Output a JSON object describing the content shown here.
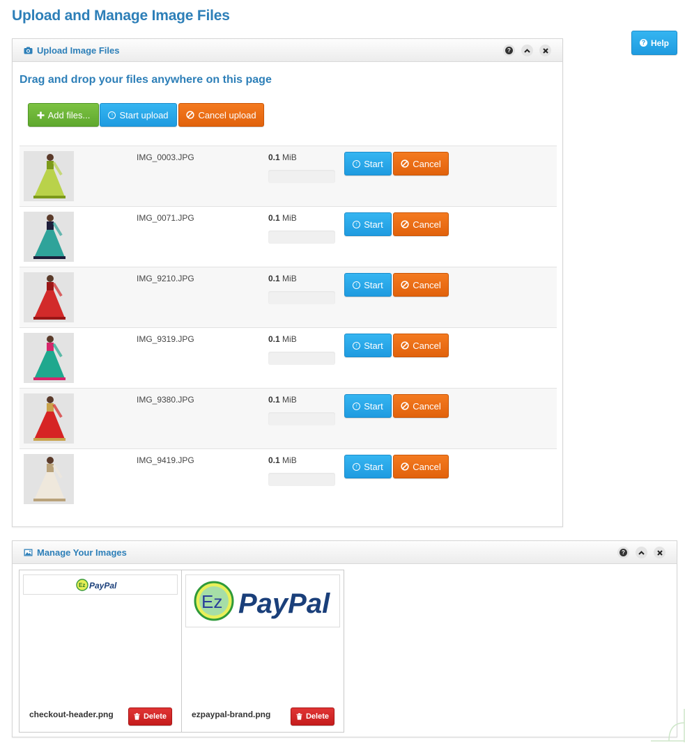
{
  "page": {
    "title": "Upload and Manage Image Files"
  },
  "help": {
    "label": "Help"
  },
  "upload": {
    "title": "Upload Image Files",
    "drag_text": "Drag and drop your files anywhere on this page",
    "add_label": "Add files...",
    "start_label": "Start upload",
    "cancel_label": "Cancel upload",
    "files": [
      {
        "name": "IMG_0003.JPG",
        "size_value": "0.1",
        "size_unit": "MiB",
        "start_label": "Start",
        "cancel_label": "Cancel",
        "dress": "#b9d24a",
        "accent": "#7c9a1a"
      },
      {
        "name": "IMG_0071.JPG",
        "size_value": "0.1",
        "size_unit": "MiB",
        "start_label": "Start",
        "cancel_label": "Cancel",
        "dress": "#2fa39a",
        "accent": "#1d1d3a"
      },
      {
        "name": "IMG_9210.JPG",
        "size_value": "0.1",
        "size_unit": "MiB",
        "start_label": "Start",
        "cancel_label": "Cancel",
        "dress": "#d22a2a",
        "accent": "#9a1616"
      },
      {
        "name": "IMG_9319.JPG",
        "size_value": "0.1",
        "size_unit": "MiB",
        "start_label": "Start",
        "cancel_label": "Cancel",
        "dress": "#1fa88e",
        "accent": "#d6266a"
      },
      {
        "name": "IMG_9380.JPG",
        "size_value": "0.1",
        "size_unit": "MiB",
        "start_label": "Start",
        "cancel_label": "Cancel",
        "dress": "#d62424",
        "accent": "#c9a24a"
      },
      {
        "name": "IMG_9419.JPG",
        "size_value": "0.1",
        "size_unit": "MiB",
        "start_label": "Start",
        "cancel_label": "Cancel",
        "dress": "#efe8dc",
        "accent": "#b9a27a"
      }
    ]
  },
  "manage": {
    "title": "Manage Your Images",
    "images": [
      {
        "name": "checkout-header.png",
        "delete_label": "Delete",
        "logo_text": "PayPal",
        "logo_mark": "Ez"
      },
      {
        "name": "ezpaypal-brand.png",
        "delete_label": "Delete",
        "logo_text": "PayPal",
        "logo_mark": "Ez"
      }
    ]
  },
  "colors": {
    "title_blue": "#2d7fb8",
    "green": "#5fa82e",
    "blue": "#1f9be0",
    "orange": "#e1620c",
    "red": "#c51d1d"
  },
  "icons": {
    "camera": "camera-icon",
    "picture": "picture-icon",
    "help": "question-circle-icon",
    "collapse": "chevron-up-icon",
    "close": "close-icon",
    "plus": "plus-icon",
    "upload": "upload-circle-icon",
    "cancel": "ban-icon",
    "trash": "trash-icon"
  }
}
